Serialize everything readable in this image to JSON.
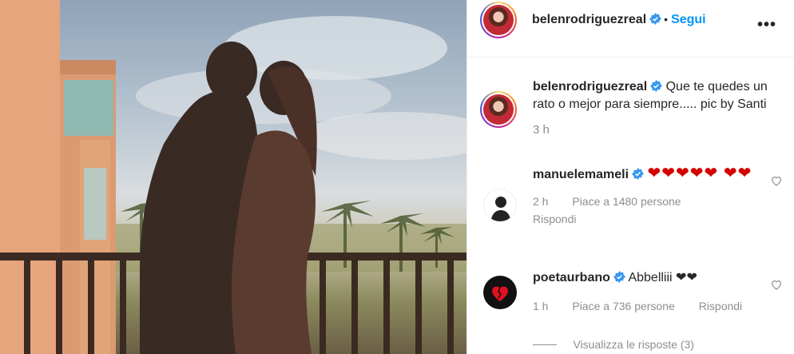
{
  "post": {
    "author": "belenrodriguezreal",
    "follow_label": "Segui",
    "separator": "•",
    "more_label": "•••",
    "caption": "Que te quedes un rato o mejor para siempre..... pic by Santi",
    "time": "3 h"
  },
  "comments": [
    {
      "username": "manuelemameli",
      "text": "❤❤❤❤❤ ❤❤",
      "time": "2 h",
      "likes": "Piace a 1480 persone",
      "reply": "Rispondi"
    },
    {
      "username": "poetaurbano",
      "text": "Abbelliii ❤❤",
      "time": "1 h",
      "likes": "Piace a 736 persone",
      "reply": "Rispondi",
      "view_replies": "Visualizza le risposte (3)"
    }
  ],
  "colors": {
    "accent": "#0095f6",
    "heart": "#d40000",
    "text": "#262626",
    "meta": "#8e8e8e"
  },
  "icons": [
    "verified-badge-icon",
    "heart-outline-icon",
    "more-options-icon",
    "broken-heart-icon"
  ]
}
